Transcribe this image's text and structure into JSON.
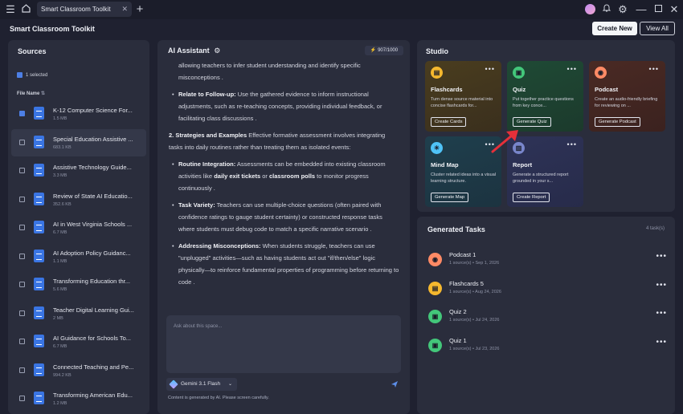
{
  "window": {
    "tab_title": "Smart Classroom Toolkit"
  },
  "icons": {
    "menu": "menu-icon",
    "home": "home-icon",
    "close": "close-icon",
    "add": "plus-icon",
    "bell": "bell-icon",
    "gear": "gear-icon",
    "minimize": "minimize-icon",
    "maximize": "maximize-icon"
  },
  "header": {
    "title": "Smart Classroom Toolkit",
    "create_new": "Create New",
    "view_all": "View All"
  },
  "sources": {
    "title": "Sources",
    "selected": "1 selected",
    "column_header": "File Name",
    "items": [
      {
        "name": "K-12 Computer Science For...",
        "size": "1.5 MB",
        "checked": true
      },
      {
        "name": "Special Education Assistive ...",
        "size": "683.1 KB",
        "checked": false
      },
      {
        "name": "Assistive Technology Guide...",
        "size": "3.3 MB",
        "checked": false
      },
      {
        "name": "Review of State AI Educatio...",
        "size": "352.6 KB",
        "checked": false
      },
      {
        "name": "AI in West Virginia Schools ...",
        "size": "6.7 MB",
        "checked": false
      },
      {
        "name": "AI Adoption Policy Guidanc...",
        "size": "1.1 MB",
        "checked": false
      },
      {
        "name": "Transforming Education thr...",
        "size": "5.6 MB",
        "checked": false
      },
      {
        "name": "Teacher Digital Learning Gui...",
        "size": "2 MB",
        "checked": false
      },
      {
        "name": "AI Guidance for Schools To...",
        "size": "6.7 MB",
        "checked": false
      },
      {
        "name": "Connected Teaching and Pe...",
        "size": "994.2 KB",
        "checked": false
      },
      {
        "name": "Transforming American Edu...",
        "size": "1.2 MB",
        "checked": false
      }
    ]
  },
  "assistant": {
    "title": "AI Assistant",
    "tokens": "907/1000",
    "line1": "allowing teachers to infer student understanding and identify specific misconceptions .",
    "b1_label": "Relate to Follow-up:",
    "b1_text": " Use the gathered evidence to inform instructional adjustments, such as re-teaching concepts, providing individual feedback, or facilitating class discussions .",
    "s2_label": "2. Strategies and Examples",
    "s2_text": " Effective formative assessment involves integrating tasks into daily routines rather than treating them as isolated events:",
    "b2_label": "Routine Integration:",
    "b2_text_a": " Assessments can be embedded into existing classroom activities like ",
    "b2_bold_a": "daily exit tickets",
    "b2_text_b": " or ",
    "b2_bold_b": "classroom polls",
    "b2_text_c": " to monitor progress continuously .",
    "b3_label": "Task Variety:",
    "b3_text": " Teachers can use multiple-choice questions (often paired with confidence ratings to gauge student certainty) or constructed response tasks where students must debug code to match a specific narrative scenario .",
    "b4_label": "Addressing Misconceptions:",
    "b4_text": " When students struggle, teachers can use \"unplugged\" activities—such as having students act out \"if/then/else\" logic physically—to reinforce fundamental properties of programming before returning to code .",
    "input_placeholder": "Ask about this space...",
    "model": "Gemini 3.1 Flash",
    "disclaimer": "Content is generated by AI. Please screen carefully."
  },
  "studio": {
    "title": "Studio",
    "cards": [
      {
        "title": "Flashcards",
        "desc": "Turn dense source material into concise flashcards for...",
        "button": "Create Cards",
        "icon": "flashcards-icon"
      },
      {
        "title": "Quiz",
        "desc": "Put together practice questions from key conce...",
        "button": "Generate Quiz",
        "icon": "quiz-icon"
      },
      {
        "title": "Podcast",
        "desc": "Create an audio-friendly briefing for reviewing on ...",
        "button": "Generate Podcast",
        "icon": "podcast-icon"
      },
      {
        "title": "Mind Map",
        "desc": "Cluster related ideas into a visual learning structure.",
        "button": "Generate Map",
        "icon": "mindmap-icon"
      },
      {
        "title": "Report",
        "desc": "Generate a structured report grounded in your s...",
        "button": "Create Report",
        "icon": "report-icon"
      }
    ]
  },
  "tasks": {
    "title": "Generated Tasks",
    "count": "4 task(s)",
    "items": [
      {
        "name": "Podcast 1",
        "meta": "1 source(s) • Sep 1, 2026",
        "icon": "podcast-icon",
        "color": "#ff8a65"
      },
      {
        "name": "Flashcards 5",
        "meta": "1 source(s) • Aug 24, 2026",
        "icon": "flashcards-icon",
        "color": "#f5b82e"
      },
      {
        "name": "Quiz 2",
        "meta": "1 source(s) • Jul 24, 2026",
        "icon": "quiz-icon",
        "color": "#43c77a"
      },
      {
        "name": "Quiz 1",
        "meta": "1 source(s) • Jul 23, 2026",
        "icon": "quiz-icon",
        "color": "#43c77a"
      }
    ]
  },
  "colors": {
    "accent": "#4d7fe5",
    "highlight_arrow": "#e5303a"
  }
}
